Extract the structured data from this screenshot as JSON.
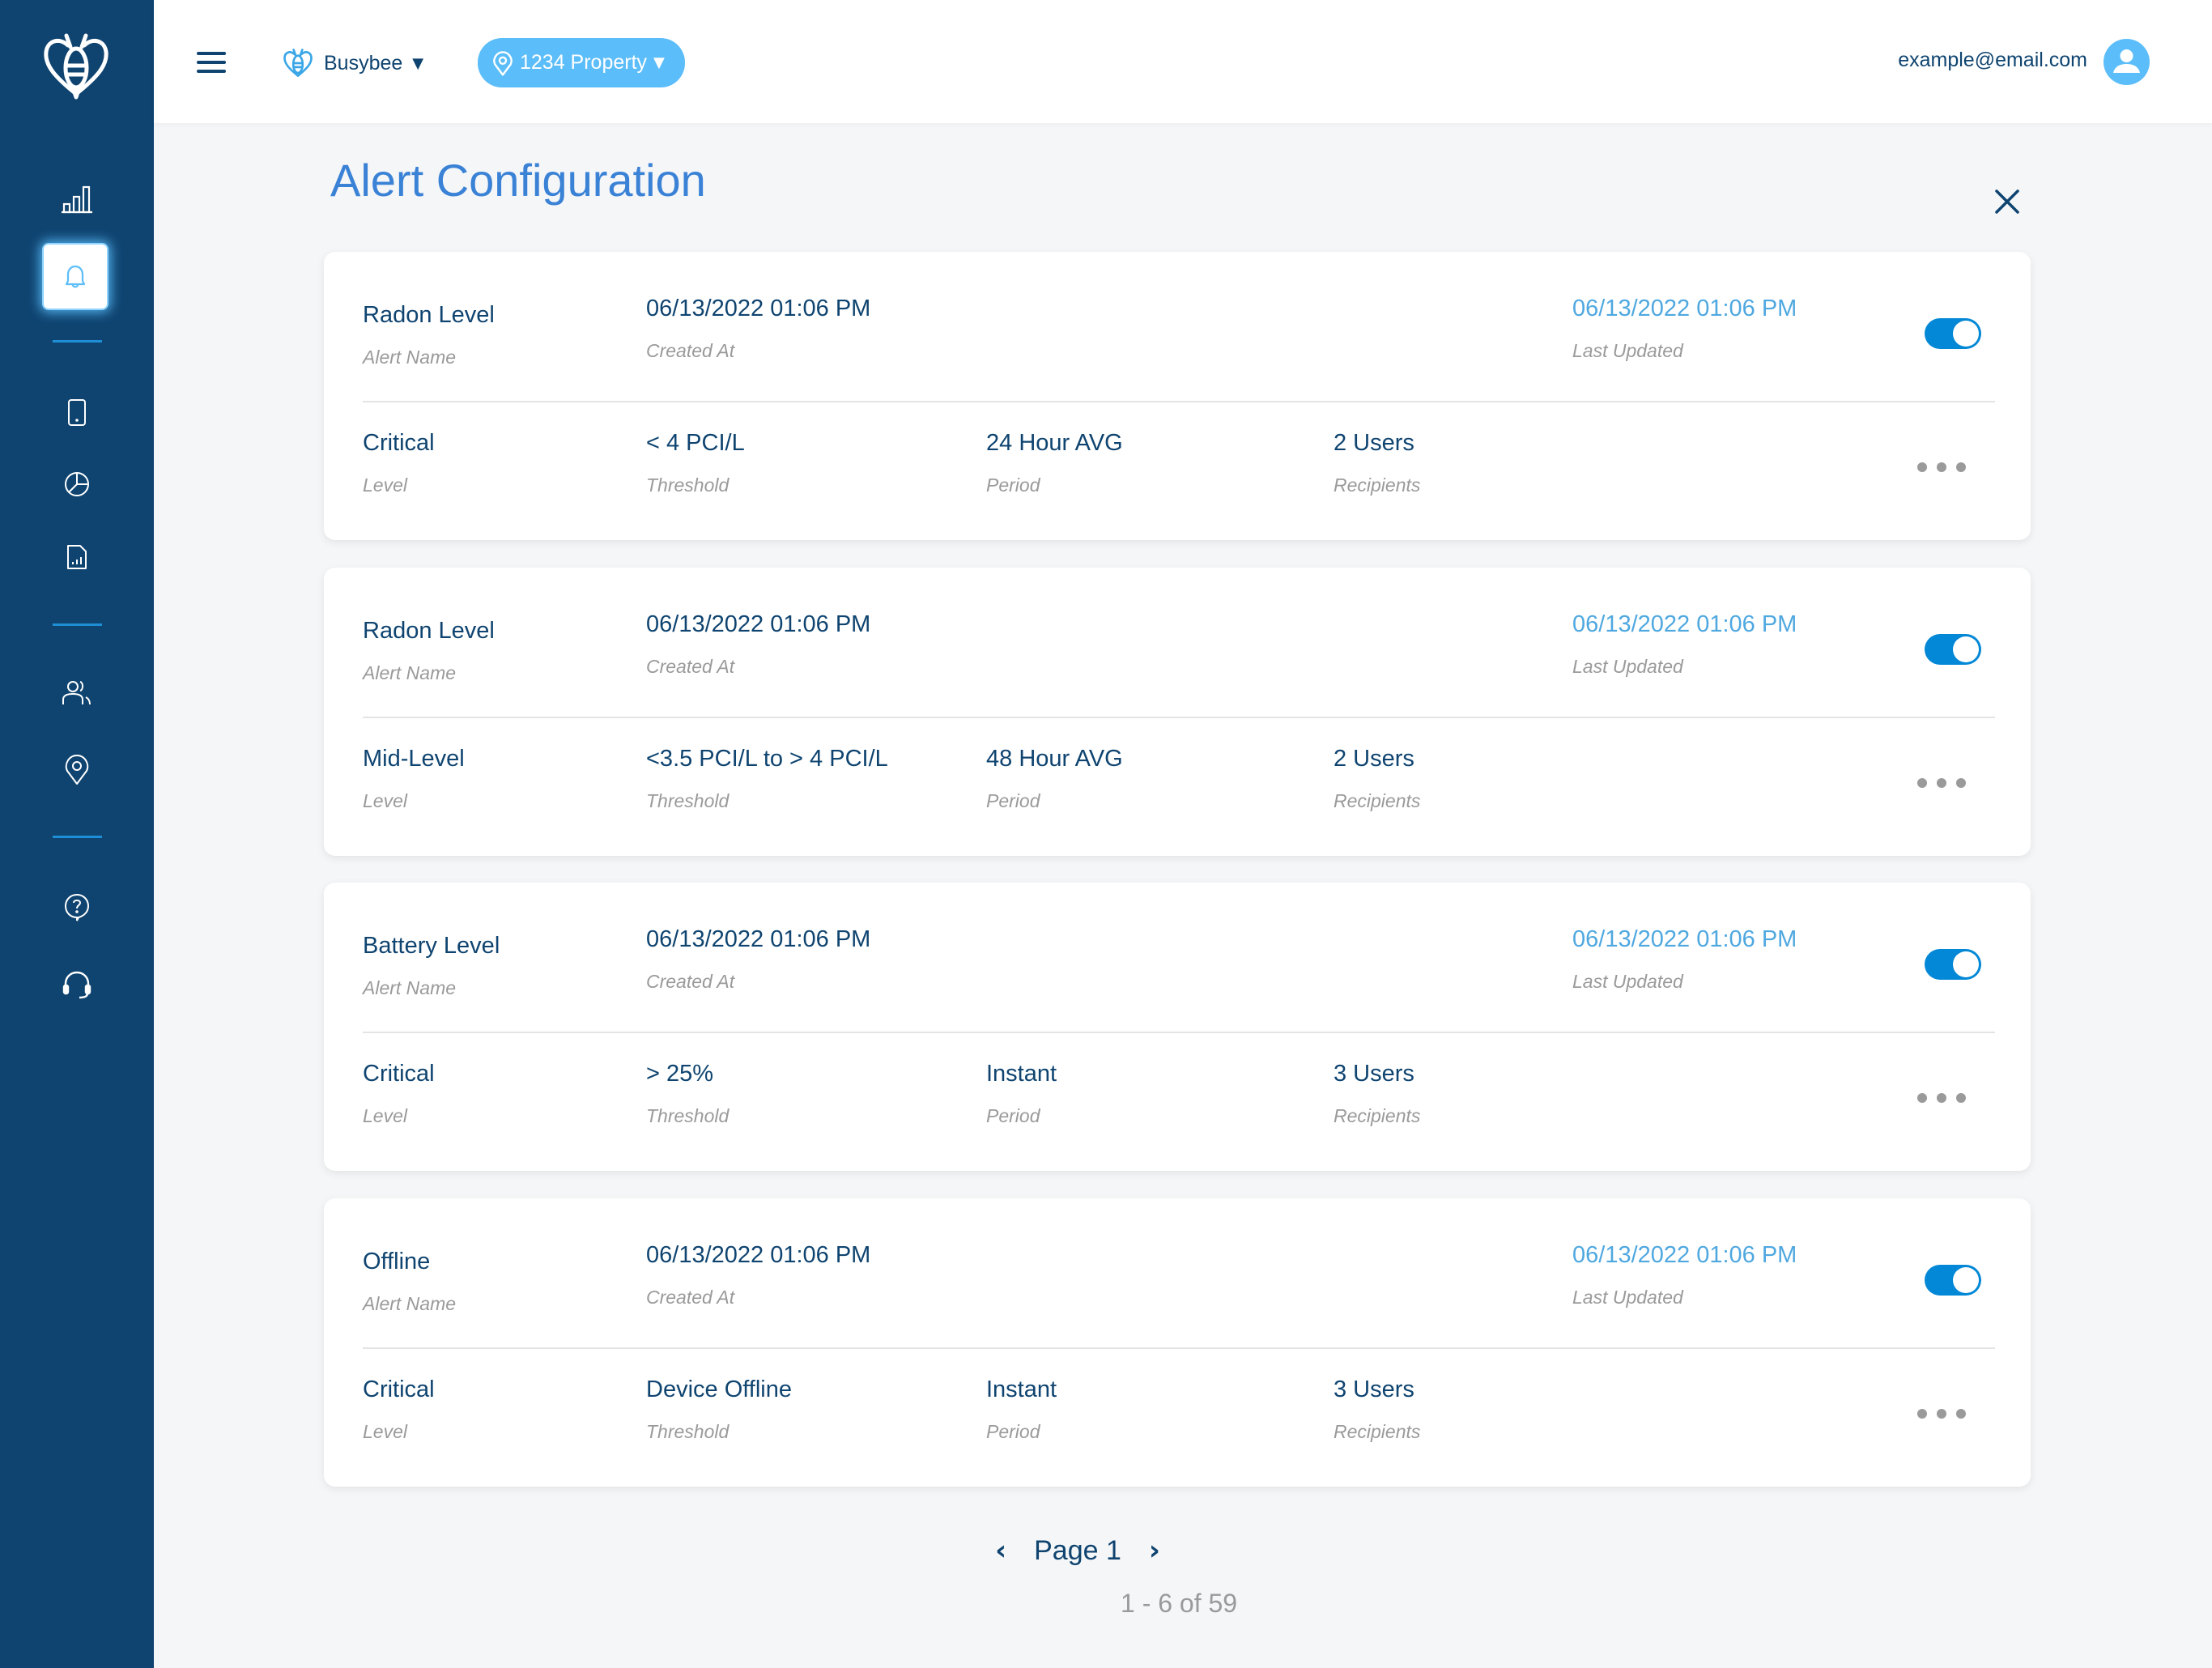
{
  "header": {
    "brand": "Busybee",
    "property": "1234 Property",
    "user_email": "example@email.com"
  },
  "sidebar": {
    "items": [
      {
        "icon": "bar-chart-icon",
        "label": "Analytics"
      },
      {
        "icon": "bell-icon",
        "label": "Alerts",
        "active": true
      },
      {
        "icon": "device-icon",
        "label": "Devices"
      },
      {
        "icon": "pie-chart-icon",
        "label": "Reports Overview"
      },
      {
        "icon": "report-file-icon",
        "label": "Reports"
      },
      {
        "icon": "users-icon",
        "label": "Users"
      },
      {
        "icon": "location-icon",
        "label": "Locations"
      },
      {
        "icon": "help-icon",
        "label": "Help"
      },
      {
        "icon": "headset-icon",
        "label": "Support"
      }
    ]
  },
  "page": {
    "title": "Alert Configuration"
  },
  "labels": {
    "alert_name": "Alert Name",
    "created_at": "Created At",
    "last_updated": "Last Updated",
    "level": "Level",
    "threshold": "Threshold",
    "period": "Period",
    "recipients": "Recipients"
  },
  "alerts": [
    {
      "name": "Radon Level",
      "created_at": "06/13/2022 01:06 PM",
      "last_updated": "06/13/2022 01:06 PM",
      "enabled": true,
      "level": "Critical",
      "threshold": "< 4 PCI/L",
      "period": "24 Hour AVG",
      "recipients": "2 Users"
    },
    {
      "name": "Radon Level",
      "created_at": "06/13/2022 01:06 PM",
      "last_updated": "06/13/2022 01:06 PM",
      "enabled": true,
      "level": "Mid-Level",
      "threshold": "<3.5 PCI/L to > 4 PCI/L",
      "period": "48 Hour AVG",
      "recipients": "2 Users"
    },
    {
      "name": "Battery Level",
      "created_at": "06/13/2022 01:06 PM",
      "last_updated": "06/13/2022 01:06 PM",
      "enabled": true,
      "level": "Critical",
      "threshold": "> 25%",
      "period": "Instant",
      "recipients": "3 Users"
    },
    {
      "name": "Offline",
      "created_at": "06/13/2022 01:06 PM",
      "last_updated": "06/13/2022 01:06 PM",
      "enabled": true,
      "level": "Critical",
      "threshold": "Device Offline",
      "period": "Instant",
      "recipients": "3 Users"
    }
  ],
  "pagination": {
    "page_label": "Page 1",
    "range": "1 - 6 of 59"
  },
  "colors": {
    "sidebar": "#0f4470",
    "accent": "#5bbdf9",
    "title": "#3a82d6",
    "toggle_on": "#0288d6",
    "updated_text": "#4fa8e0"
  }
}
